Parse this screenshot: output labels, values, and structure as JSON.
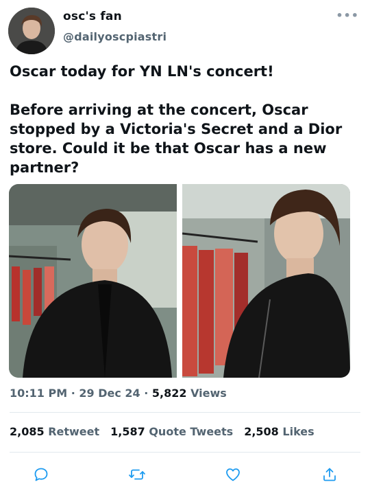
{
  "author": {
    "name": "osc's fan",
    "handle": "@dailyoscpiastri",
    "more_icon": "more-icon"
  },
  "tweet": {
    "text": "Oscar today for YN LN's concert!\n\nBefore arriving at the concert, Oscar stopped by a Victoria's Secret and a Dior store. Could it be that Oscar has a new partner?",
    "media": [
      {
        "kind": "photo"
      },
      {
        "kind": "photo"
      }
    ]
  },
  "meta": {
    "time": "10:11 PM",
    "sep1": " · ",
    "date": "29 Dec 24",
    "sep2": " · ",
    "views_count": "5,822",
    "views_label": " Views"
  },
  "stats": {
    "retweets_count": "2,085",
    "retweets_label": "Retweet",
    "quotes_count": "1,587",
    "quotes_label": "Quote Tweets",
    "likes_count": "2,508",
    "likes_label": "Likes"
  },
  "actions": [
    "reply-icon",
    "retweet-icon",
    "like-icon",
    "share-icon"
  ],
  "colors": {
    "secondary_text": "#536471",
    "icon_blue": "#1d9bf0",
    "divider": "#e1e8ed"
  }
}
